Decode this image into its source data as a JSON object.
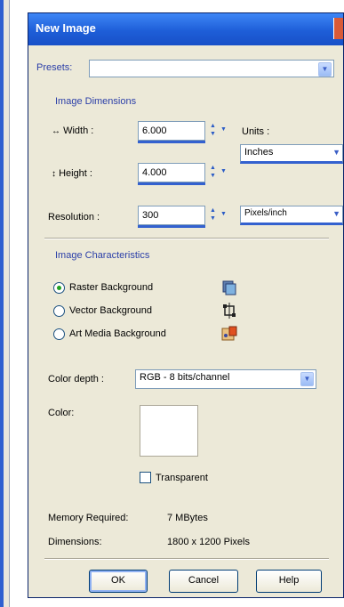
{
  "window": {
    "title": "New Image"
  },
  "presets": {
    "label": "Presets:",
    "value": ""
  },
  "image_dimensions": {
    "heading": "Image Dimensions",
    "width": {
      "label": "Width :",
      "value": "6.000"
    },
    "height": {
      "label": "Height :",
      "value": "4.000"
    },
    "units": {
      "label": "Units :",
      "value": "Inches"
    },
    "resolution": {
      "label": "Resolution :",
      "value": "300",
      "unit": "Pixels/inch"
    }
  },
  "image_characteristics": {
    "heading": "Image Characteristics",
    "options": [
      {
        "label": "Raster Background",
        "selected": true,
        "icon": "raster-icon"
      },
      {
        "label": "Vector Background",
        "selected": false,
        "icon": "vector-icon"
      },
      {
        "label": "Art Media Background",
        "selected": false,
        "icon": "art-media-icon"
      }
    ],
    "color_depth": {
      "label": "Color depth :",
      "value": "RGB - 8 bits/channel"
    },
    "color": {
      "label": "Color:",
      "swatch": "#ffffff"
    },
    "transparent": {
      "label": "Transparent",
      "checked": false
    }
  },
  "info": {
    "memory_label": "Memory Required:",
    "memory_value": "7 MBytes",
    "dimensions_label": "Dimensions:",
    "dimensions_value": "1800 x 1200 Pixels"
  },
  "buttons": {
    "ok": "OK",
    "cancel": "Cancel",
    "help": "Help"
  },
  "colors": {
    "title_bar": "#1e5ed8",
    "heading": "#2b3fa8",
    "dialog_bg": "#ece9d8",
    "accent_underline": "#3361cf"
  }
}
